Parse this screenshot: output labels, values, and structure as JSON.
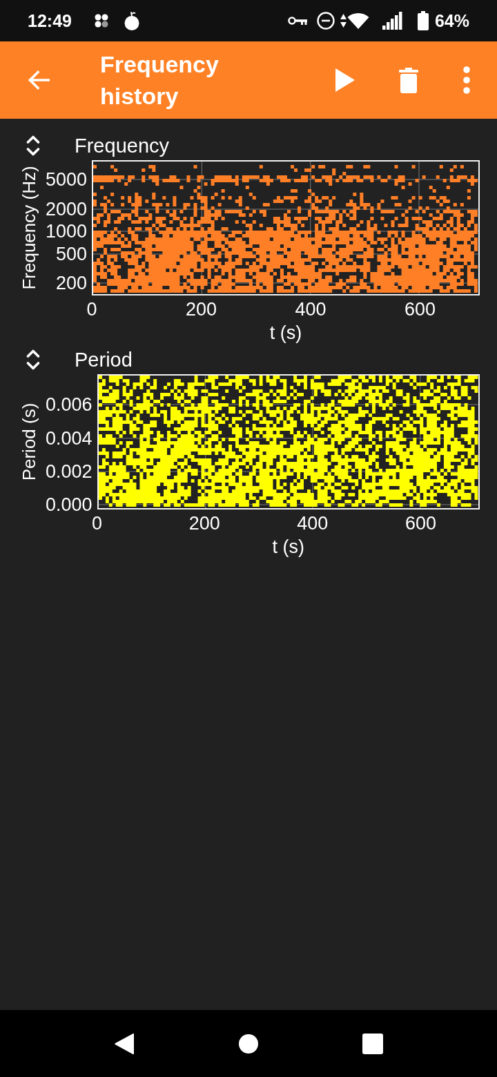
{
  "status_bar": {
    "time": "12:49",
    "battery": "64%"
  },
  "app_bar": {
    "title": "Frequency history"
  },
  "charts": [
    {
      "title": "Frequency",
      "ylabel": "Frequency (Hz)",
      "y_tick_labels": [
        "5000",
        "2000",
        "1000",
        "500",
        "200"
      ],
      "x_tick_labels": [
        "0",
        "200",
        "400",
        "600"
      ],
      "xlabel": "t (s)",
      "color": "#ff7f27"
    },
    {
      "title": "Period",
      "ylabel": "Period (s)",
      "y_tick_labels": [
        "0.006",
        "0.004",
        "0.002",
        "0.000"
      ],
      "x_tick_labels": [
        "0",
        "200",
        "400",
        "600"
      ],
      "xlabel": "t (s)",
      "color": "#ffff00"
    }
  ]
}
